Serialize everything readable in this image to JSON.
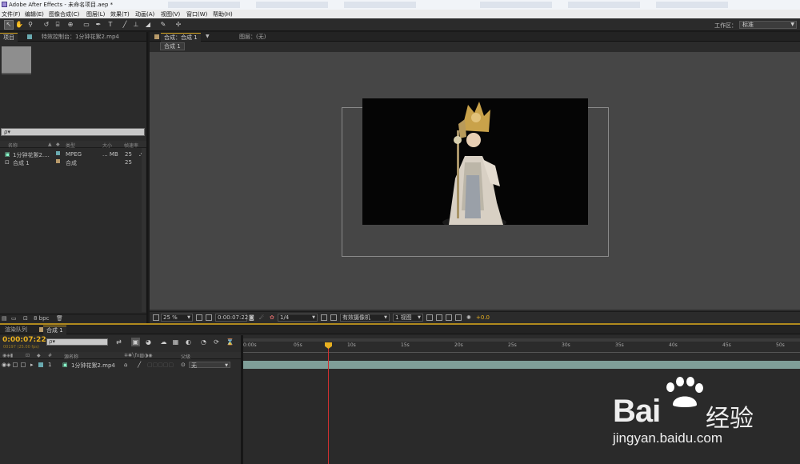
{
  "titlebar": {
    "title": "Adobe After Effects - 未命名项目.aep *"
  },
  "menubar": {
    "items": [
      "文件(F)",
      "编辑(E)",
      "图像合成(C)",
      "图层(L)",
      "效果(T)",
      "动画(A)",
      "视图(V)",
      "窗口(W)",
      "帮助(H)"
    ]
  },
  "toolbar": {
    "tools": [
      "selection-tool",
      "hand-tool",
      "zoom-tool",
      "rotate-tool",
      "unified-camera-tool",
      "pan-behind-tool",
      "rectangle-mask-tool",
      "pen-tool",
      "type-tool",
      "brush-tool",
      "clone-stamp-tool",
      "eraser-tool",
      "roto-brush-tool",
      "puppet-pin-tool"
    ],
    "workspace_label": "工作区：",
    "workspace_value": "标准"
  },
  "project_panel": {
    "tab_project": "项目",
    "tab_effects": "特效控制台：1分钟花絮2.mp4",
    "search_placeholder": "ρ▾",
    "columns": {
      "name": "名称",
      "type": "类型",
      "size": "大小",
      "fps": "帧速率"
    },
    "items": [
      {
        "name": "1分钟花絮2....",
        "type": "MPEG",
        "size": "... MB",
        "fps": "25",
        "color": "#6aaab0"
      },
      {
        "name": "合成 1",
        "type": "合成",
        "size": "",
        "fps": "25",
        "color": "#b89a6a"
      }
    ],
    "bpc": "8 bpc"
  },
  "comp_panel": {
    "tab_comp": "合成：合成 1",
    "tab_layer": "图层：(无)",
    "flow_tab": "合成 1",
    "footer": {
      "zoom": "25 %",
      "timecode": "0:00:07:22",
      "resolution": "1/4",
      "camera": "有效摄像机",
      "views": "1 视图",
      "exposure": "+0.0"
    }
  },
  "timeline": {
    "tab_render": "渲染队列",
    "tab_comp": "合成 1",
    "timecode": "0:00:07:22",
    "frames": "00197 (25.00 fps)",
    "search_placeholder": "ρ▾",
    "header": {
      "num": "#",
      "name": "源名称",
      "parent": "父级"
    },
    "layer": {
      "index": "1",
      "name": "1分钟花絮2.mp4",
      "parent": "无"
    },
    "ruler_ticks": [
      "0:00s",
      "05s",
      "10s",
      "15s",
      "20s",
      "25s",
      "30s",
      "35s",
      "40s",
      "45s",
      "50s"
    ],
    "playhead_seconds": 7.88
  },
  "watermark": {
    "main": "Bai",
    "cn": "经验",
    "url": "jingyan.baidu.com"
  }
}
